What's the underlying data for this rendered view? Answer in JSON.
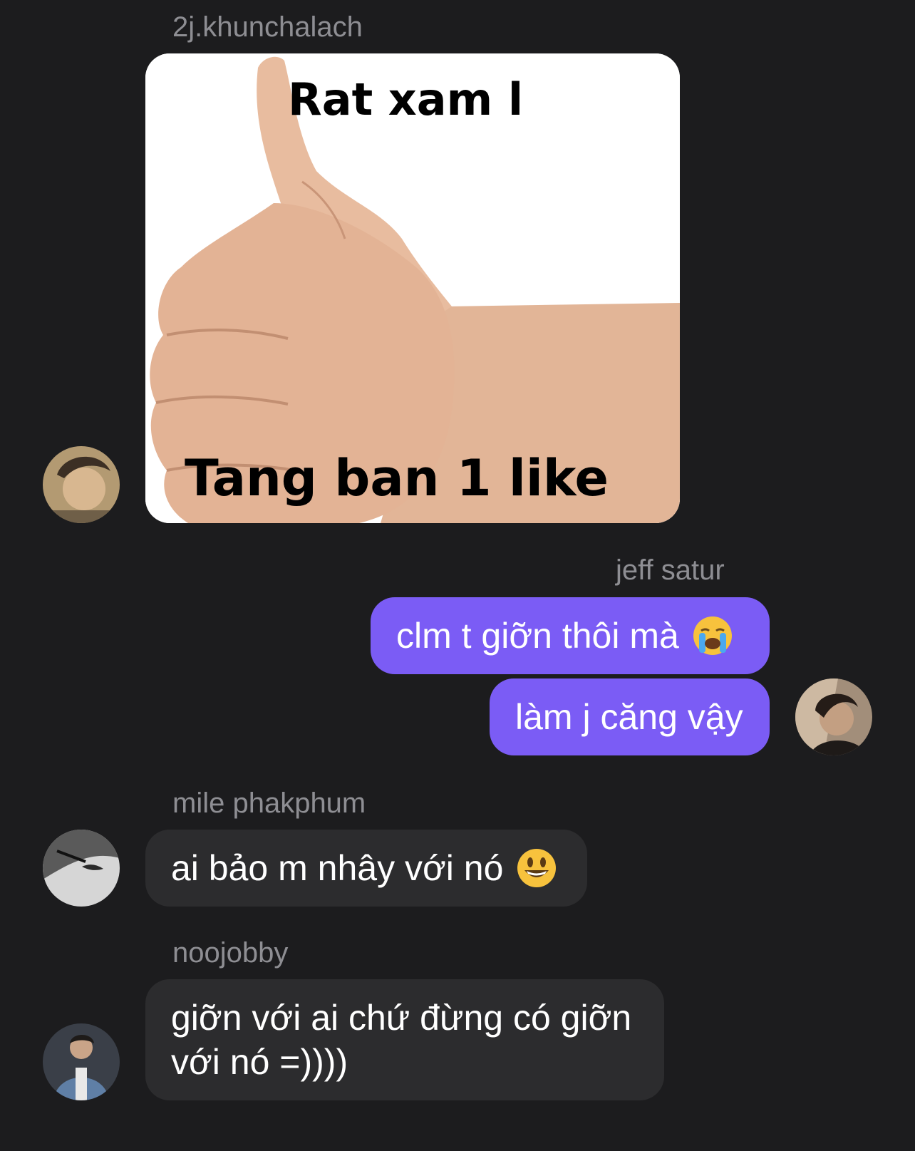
{
  "messages": [
    {
      "sender": "2j.khunchalach",
      "type": "image",
      "image": {
        "description": "thumbs-up hand meme",
        "top_text": "Rat xam l",
        "bottom_text": "Tang ban 1 like"
      }
    },
    {
      "sender": "jeff satur",
      "type": "text-group",
      "bubbles": [
        {
          "text": "clm t giỡn thôi mà",
          "emoji": "loudly-crying-face-emoji"
        },
        {
          "text": "làm j căng vậy"
        }
      ]
    },
    {
      "sender": "mile phakphum",
      "type": "text",
      "text": "ai bảo m nhây với nó",
      "emoji": "grinning-face-emoji"
    },
    {
      "sender": "noojobby",
      "type": "text",
      "line1": "giỡn với ai chứ đừng có giỡn",
      "line2": "với nó =))))"
    }
  ],
  "colors": {
    "background": "#1c1c1e",
    "incoming_bubble": "#2c2c2e",
    "outgoing_bubble": "#7b5cf5",
    "sender_name": "#8e8e93"
  }
}
